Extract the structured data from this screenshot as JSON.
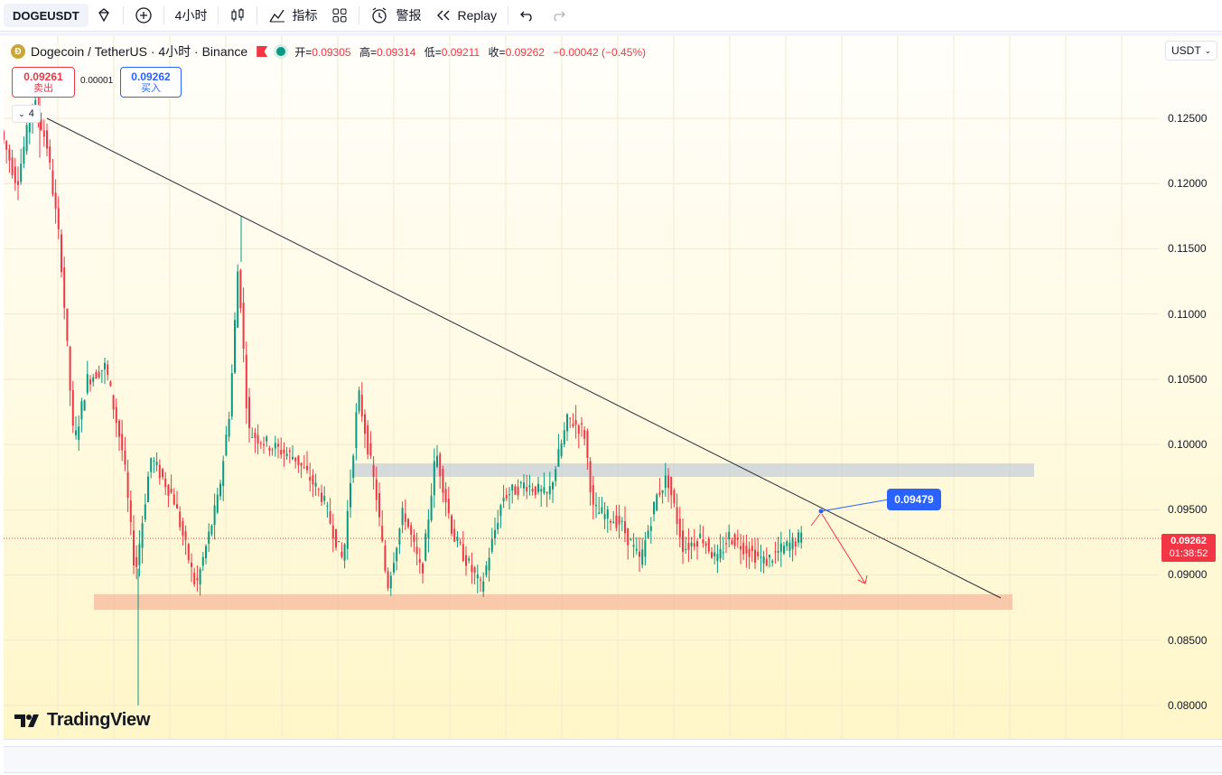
{
  "toolbar": {
    "symbol": "DOGEUSDT",
    "interval": "4小时",
    "indicators": "指标",
    "alerts": "警报",
    "replay": "Replay"
  },
  "legend": {
    "name": "Dogecoin / TetherUS · 4小时 · Binance",
    "open_label": "开=",
    "open": "0.09305",
    "high_label": "高=",
    "high": "0.09314",
    "low_label": "低=",
    "low": "0.09211",
    "close_label": "收=",
    "close": "0.09262",
    "change": "−0.00042 (−0.45%)"
  },
  "trade": {
    "sell_price": "0.09261",
    "sell_label": "卖出",
    "spread": "0.00001",
    "buy_price": "0.09262",
    "buy_label": "买入"
  },
  "collapse_count": "4",
  "currency": "USDT",
  "price_axis": [
    "0.12500",
    "0.12000",
    "0.11500",
    "0.11000",
    "0.10500",
    "0.10000",
    "0.09500",
    "0.09000",
    "0.08500",
    "0.08000"
  ],
  "last_price": {
    "value": "0.09262",
    "countdown": "01:38:52"
  },
  "callout": "0.09479",
  "logo": "TradingView",
  "colors": {
    "up": "#089981",
    "down": "#f23645",
    "accent": "#2962ff"
  }
}
